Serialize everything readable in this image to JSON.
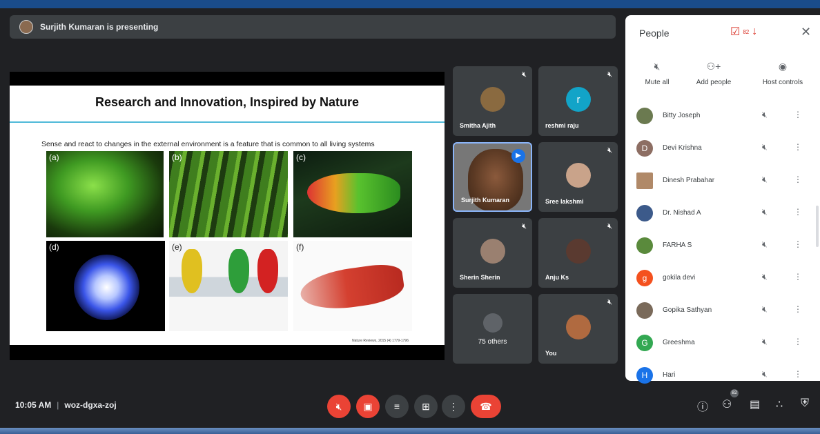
{
  "presenting": {
    "text": "Surjith Kumaran is presenting"
  },
  "slide": {
    "title": "Research and Innovation, Inspired by Nature",
    "caption": "Sense and react to changes in the external environment is a feature that is common to all living systems",
    "panel_labels": [
      "(a)",
      "(b)",
      "(c)",
      "(d)",
      "(e)",
      "(f)"
    ],
    "reference": "Nature Reviews, 2015 (4) 1779-1796"
  },
  "tiles": [
    {
      "name": "Smitha Ajith",
      "muted": true
    },
    {
      "name": "reshmi raju",
      "initial": "r",
      "muted": true
    },
    {
      "name": "Surjith Kumaran",
      "speaking": true
    },
    {
      "name": "Sree lakshmi",
      "muted": true
    },
    {
      "name": "Sherin Sherin",
      "muted": true
    },
    {
      "name": "Anju Ks",
      "muted": true
    },
    {
      "name": "75 others"
    },
    {
      "name": "You",
      "muted": true
    }
  ],
  "people_panel": {
    "title": "People",
    "count": "82",
    "controls": [
      {
        "label": "Mute all",
        "icon": "mic-off-icon"
      },
      {
        "label": "Add people",
        "icon": "add-person-icon"
      },
      {
        "label": "Host controls",
        "icon": "toggle-icon"
      }
    ],
    "people": [
      {
        "name": "Bitty Joseph",
        "avatar_color": "#6b7a50"
      },
      {
        "name": "Devi Krishna",
        "initial": "D",
        "avatar_color": "#8d6e63"
      },
      {
        "name": "Dinesh Prabahar",
        "avatar_color": "#b08968"
      },
      {
        "name": "Dr. Nishad A",
        "avatar_color": "#3c5a8a"
      },
      {
        "name": "FARHA S",
        "avatar_color": "#5a8a3c"
      },
      {
        "name": "gokila devi",
        "initial": "g",
        "avatar_color": "#f4511e"
      },
      {
        "name": "Gopika Sathyan",
        "avatar_color": "#7a6a5a"
      },
      {
        "name": "Greeshma",
        "initial": "G",
        "avatar_color": "#33a852"
      },
      {
        "name": "Hari",
        "initial": "H",
        "avatar_color": "#1a73e8"
      }
    ]
  },
  "meeting": {
    "time": "10:05 AM",
    "code": "woz-dgxa-zoj"
  },
  "people_badge": "82",
  "colors": {
    "danger": "#ea4335",
    "accent": "#1a73e8",
    "bg": "#202124"
  }
}
